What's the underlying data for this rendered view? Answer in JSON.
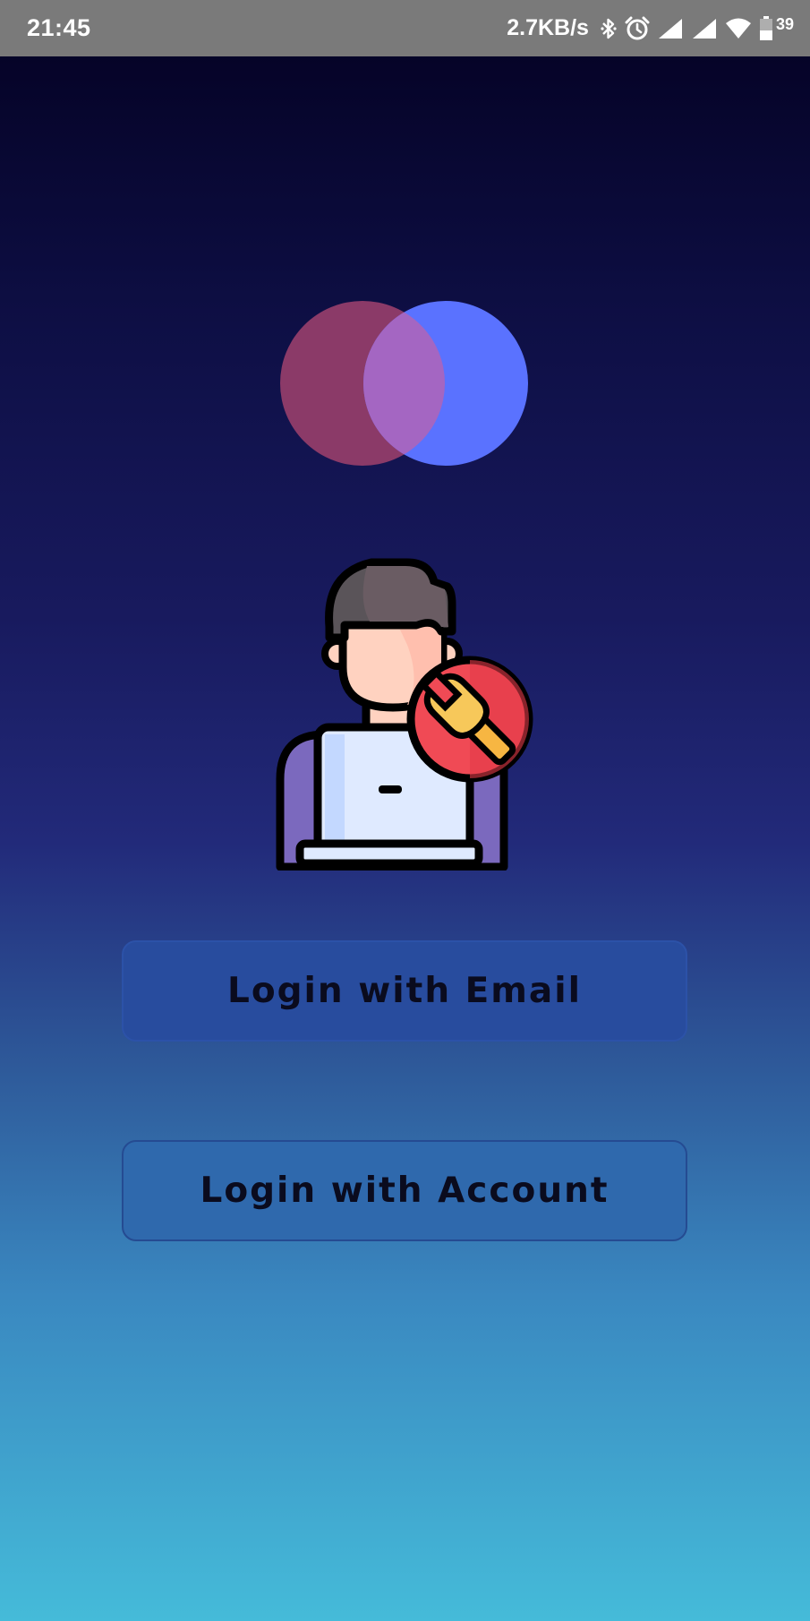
{
  "status_bar": {
    "time": "21:45",
    "network_speed": "2.7KB/s",
    "battery_level": "39",
    "icons": [
      "bluetooth-icon",
      "alarm-icon",
      "signal-icon",
      "signal-icon",
      "wifi-icon",
      "battery-icon"
    ]
  },
  "logo": {
    "icon": "overlapping-circles-logo",
    "colors": {
      "left_circle": "#8b3a68",
      "right_circle": "#5a72ff",
      "overlap": "#a466c2"
    }
  },
  "illustration": {
    "icon": "tech-support-person-with-wrench-icon"
  },
  "buttons": {
    "email_label": "Login with Email",
    "account_label": "Login with Account"
  },
  "colors": {
    "gradient_top": "#050327",
    "gradient_bottom": "#45bbd9",
    "button_email_bg": "#284c9e",
    "button_account_bg": "#2f69ad",
    "button_text": "#0a0b1e"
  }
}
